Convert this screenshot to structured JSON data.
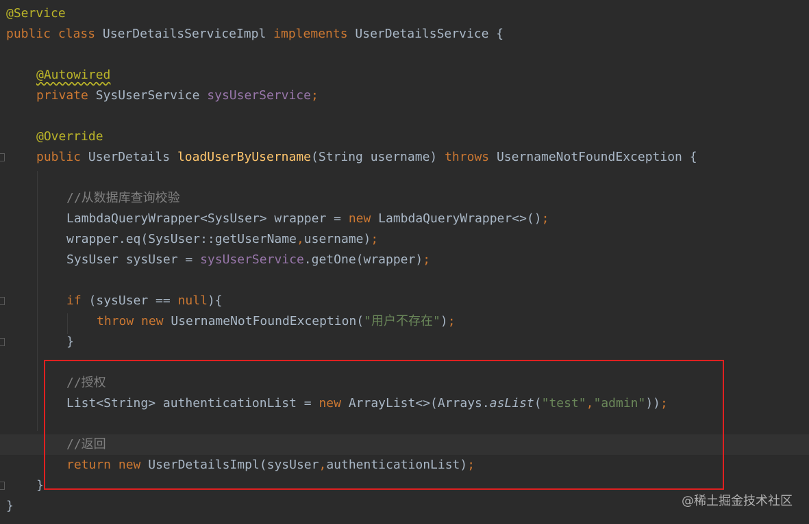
{
  "code": {
    "l1": {
      "ann": "@Service"
    },
    "l2": {
      "kw1": "public",
      "kw2": "class",
      "name": "UserDetailsServiceImpl",
      "kw3": "implements",
      "iface": "UserDetailsService {"
    },
    "l4": {
      "ann": "@Autowired"
    },
    "l5": {
      "kw": "private",
      "type": "SysUserService",
      "field": "sysUserService",
      "semi": ";"
    },
    "l7": {
      "ann": "@Override"
    },
    "l8": {
      "kw1": "public",
      "type": "UserDetails",
      "fn": "loadUserByUsername",
      "params": "(String username)",
      "kw2": "throws",
      "exc": "UsernameNotFoundException {"
    },
    "l10": {
      "comment": "//从数据库查询校验"
    },
    "l11": {
      "p1": "LambdaQueryWrapper<SysUser> wrapper = ",
      "kw": "new",
      "p2": " LambdaQueryWrapper<>()",
      "semi": ";"
    },
    "l12": {
      "p1": "wrapper.eq(SysUser::getUserName",
      "comma": ",",
      "p2": "username)",
      "semi": ";"
    },
    "l13": {
      "p1": "SysUser sysUser = ",
      "field": "sysUserService",
      "p2": ".getOne(wrapper)",
      "semi": ";"
    },
    "l15": {
      "kw": "if",
      "p1": " (sysUser == ",
      "kw2": "null",
      "p2": "){"
    },
    "l16": {
      "kw1": "throw",
      "kw2": "new",
      "p1": " UsernameNotFoundException(",
      "str": "\"用户不存在\"",
      "p2": ")",
      "semi": ";"
    },
    "l17": {
      "text": "}"
    },
    "l19": {
      "comment": "//授权"
    },
    "l20": {
      "p1": "List<String> authenticationList = ",
      "kw": "new",
      "p2": " ArrayList<>(Arrays.",
      "method": "asList",
      "p3": "(",
      "s1": "\"test\"",
      "comma": ",",
      "s2": "\"admin\"",
      "p4": "))",
      "semi": ";"
    },
    "l22": {
      "comment": "//返回"
    },
    "l23": {
      "kw1": "return",
      "kw2": "new",
      "p1": " UserDetailsImpl(sysUser",
      "comma": ",",
      "p2": "authenticationList)",
      "semi": ";"
    },
    "l24": {
      "text": "}"
    },
    "l25": {
      "text": "}"
    }
  },
  "watermark": "@稀土掘金技术社区",
  "colors": {
    "background": "#2b2b2b",
    "keyword": "#cc7832",
    "annotation": "#bbb529",
    "field": "#9876aa",
    "method": "#ffc66d",
    "string": "#6a8759",
    "comment": "#808080",
    "text": "#a9b7c6",
    "highlight_box": "#e02020"
  }
}
